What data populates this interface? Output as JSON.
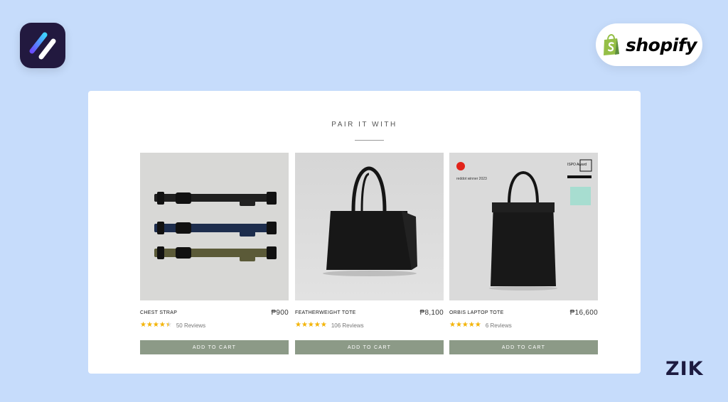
{
  "brand": {
    "app_logo": "app-logo-icon",
    "shopify_label": "shopify",
    "watermark": "ZIK"
  },
  "colors": {
    "background": "#c6dcfb",
    "button": "#8c9a87",
    "star": "#f5b400",
    "shopify_green": "#95bf47"
  },
  "section": {
    "title": "PAIR IT WITH"
  },
  "products": [
    {
      "name": "CHEST STRAP",
      "price": "₱900",
      "rating": 4.5,
      "reviews": "50 Reviews",
      "button": "ADD TO CART",
      "image": "chest-strap-image"
    },
    {
      "name": "FEATHERWEIGHT TOTE",
      "price": "₱8,100",
      "rating": 5,
      "reviews": "106 Reviews",
      "button": "ADD TO CART",
      "image": "tote-bag-image"
    },
    {
      "name": "ORBIS LAPTOP TOTE",
      "price": "₱16,600",
      "rating": 5,
      "reviews": "6 Reviews",
      "button": "ADD TO CART",
      "image": "laptop-tote-image",
      "badges": {
        "award": "reddot winner 2023",
        "ispo": "ISPO Award"
      }
    }
  ]
}
